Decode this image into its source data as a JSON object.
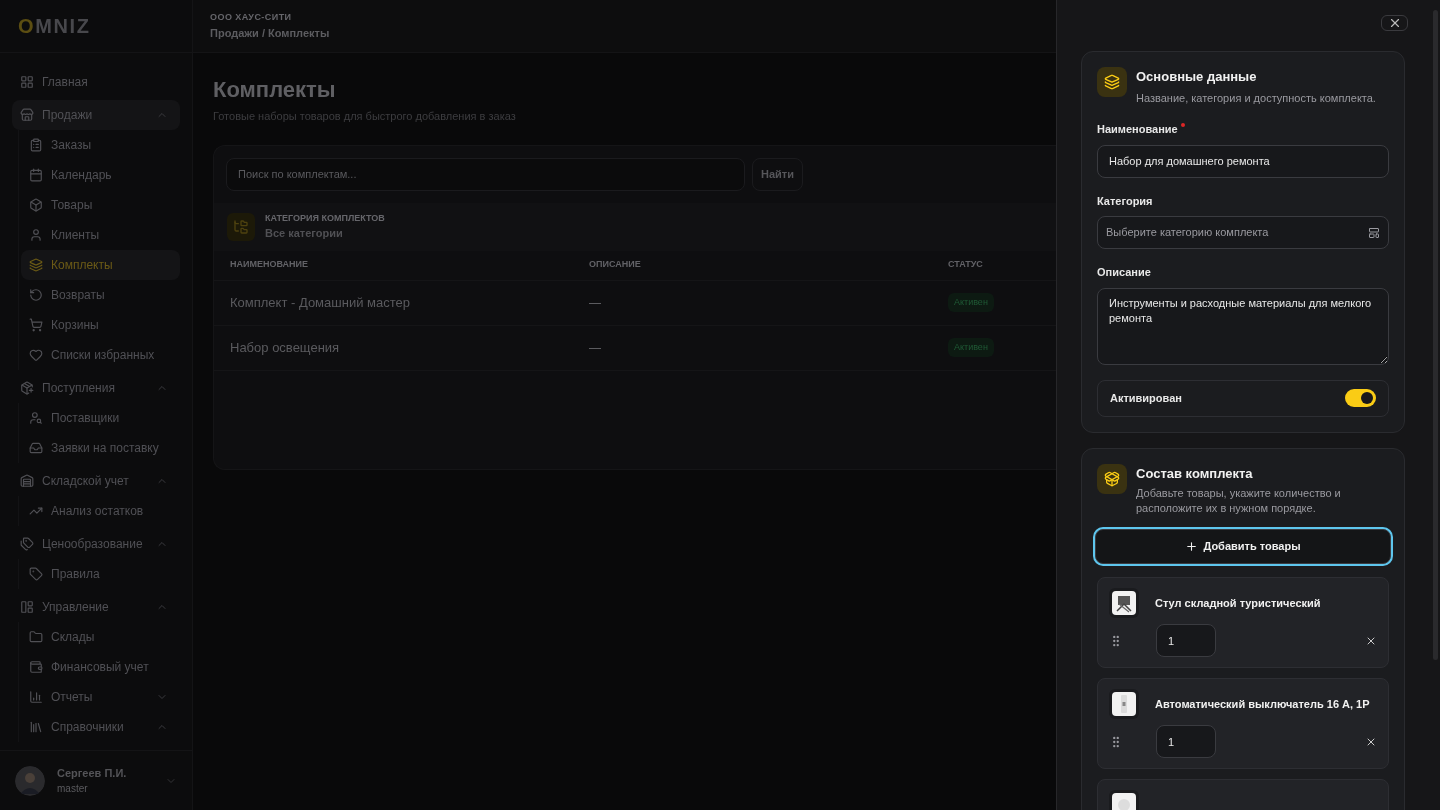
{
  "logo": {
    "first": "O",
    "rest": "MNIZ"
  },
  "sidebar": {
    "items": [
      {
        "label": "Главная",
        "selected": false
      },
      {
        "label": "Продажи",
        "selected": false,
        "expanded": true,
        "children": [
          {
            "label": "Заказы",
            "selected": false
          },
          {
            "label": "Календарь",
            "selected": false
          },
          {
            "label": "Товары",
            "selected": false
          },
          {
            "label": "Клиенты",
            "selected": false
          },
          {
            "label": "Комплекты",
            "selected": true
          },
          {
            "label": "Возвраты",
            "selected": false
          },
          {
            "label": "Корзины",
            "selected": false
          },
          {
            "label": "Списки избранных",
            "selected": false
          }
        ]
      },
      {
        "label": "Поступления",
        "selected": false,
        "expanded": true,
        "children": [
          {
            "label": "Поставщики",
            "selected": false
          },
          {
            "label": "Заявки на поставку",
            "selected": false
          }
        ]
      },
      {
        "label": "Складской учет",
        "selected": false,
        "expanded": true,
        "children": [
          {
            "label": "Анализ остатков",
            "selected": false
          }
        ]
      },
      {
        "label": "Ценообразование",
        "selected": false,
        "expanded": true,
        "children": [
          {
            "label": "Правила",
            "selected": false
          }
        ]
      },
      {
        "label": "Управление",
        "selected": false,
        "expanded": true,
        "children": [
          {
            "label": "Склады",
            "selected": false
          },
          {
            "label": "Финансовый учет",
            "selected": false
          },
          {
            "label": "Отчеты",
            "selected": false,
            "expanded": false
          },
          {
            "label": "Справочники",
            "selected": false,
            "expanded": true
          }
        ]
      }
    ],
    "user": {
      "name": "Сергеев П.И.",
      "role": "master"
    }
  },
  "header": {
    "company": "ООО ХАУС-СИТИ",
    "breadcrumb": "Продажи / Комплекты"
  },
  "page": {
    "title": "Комплекты",
    "subtitle": "Готовые наборы товаров для быстрого добавления в заказ",
    "search": {
      "placeholder": "Поиск по комплектам..."
    },
    "search_button": "Найти",
    "category": {
      "label": "КАТЕГОРИЯ КОМПЛЕКТОВ",
      "value": "Все категории"
    },
    "table": {
      "columns": [
        "НАИМЕНОВАНИЕ",
        "ОПИСАНИЕ",
        "СТАТУС"
      ],
      "rows": [
        {
          "name": "Комплект - Домашний мастер",
          "description": "—",
          "status": "Активен"
        },
        {
          "name": "Набор освещения",
          "description": "—",
          "status": "Активен"
        }
      ]
    }
  },
  "drawer": {
    "basic": {
      "title": "Основные данные",
      "subtitle": "Название, категория и доступность комплекта.",
      "name_label": "Наименование",
      "name_required": true,
      "name_value": "Набор для домашнего ремонта",
      "category_label": "Категория",
      "category_placeholder": "Выберите категорию комплекта",
      "description_label": "Описание",
      "description_value": "Инструменты и расходные материалы для мелкого ремонта",
      "active": {
        "label": "Активирован",
        "on": true
      }
    },
    "composition": {
      "title": "Состав комплекта",
      "subtitle": "Добавьте товары, укажите количество и расположите их в нужном порядке.",
      "add_button": "Добавить товары",
      "items": [
        {
          "kind": "full",
          "name": "Стул складной туристический",
          "quantity": "1"
        },
        {
          "kind": "full",
          "name": "Автоматический выключатель 16 А, 1Р",
          "quantity": "1"
        },
        {
          "kind": "cut"
        }
      ]
    }
  }
}
